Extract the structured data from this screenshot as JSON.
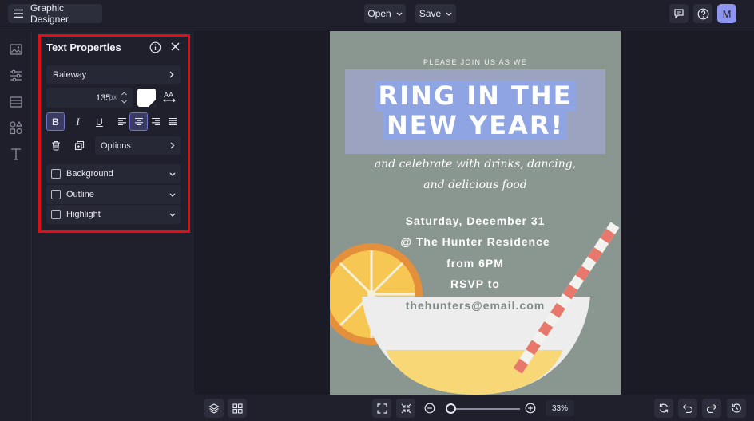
{
  "app": {
    "title": "Graphic Designer"
  },
  "toolbar": {
    "open_label": "Open",
    "save_label": "Save",
    "avatar_initial": "M"
  },
  "panel": {
    "title": "Text Properties",
    "font": "Raleway",
    "size_value": "135",
    "size_unit": "px",
    "color": "#ffffff",
    "bold_active": true,
    "align_active": "center",
    "options_label": "Options",
    "sections": [
      "Background",
      "Outline",
      "Highlight"
    ]
  },
  "poster": {
    "intro": "PLEASE JOIN US AS WE",
    "title_line1": "RING IN THE",
    "title_line2": "NEW YEAR!",
    "script_line1": "and celebrate with drinks, dancing,",
    "script_line2": "and delicious food",
    "details": [
      "Saturday, December 31",
      "@ The Hunter Residence",
      "from 6PM",
      "RSVP to"
    ],
    "email": "thehunters@email.com",
    "background_color": "#8a9690"
  },
  "zoom": {
    "label": "33%",
    "level": 0.33
  },
  "colors": {
    "accent": "#8d95ef",
    "highlight_outline": "#e10e14",
    "panel_bg": "#1f202c"
  }
}
